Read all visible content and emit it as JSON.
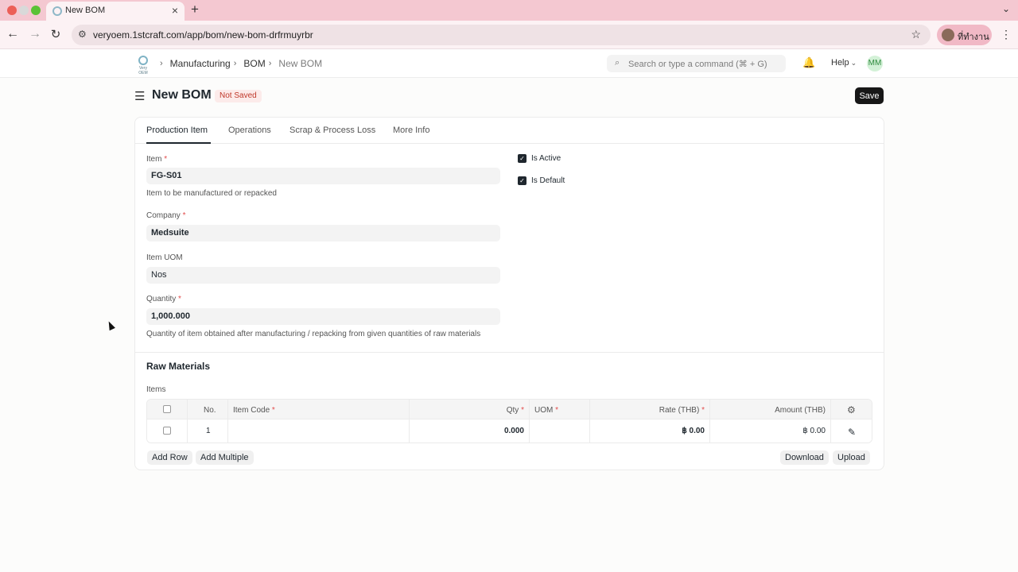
{
  "browser": {
    "tab_title": "New BOM",
    "tab_close": "×",
    "new_tab": "+",
    "tab_menu": "⌄",
    "nav_back": "←",
    "nav_forward": "→",
    "nav_reload": "↻",
    "site_info": "⚙",
    "url": "veryoem.1stcraft.com/app/bom/new-bom-drfrmuyrbr",
    "star": "☆",
    "profile_name": "ที่ทำงาน",
    "kebab": "⋮"
  },
  "navbar": {
    "logo_text": "Very OEM",
    "breadcrumbs": [
      "Manufacturing",
      "BOM",
      "New BOM"
    ],
    "crumb_separator": "›",
    "search_placeholder": "Search or type a command (⌘ + G)",
    "search_icon": "⌕",
    "bell_icon": "🔔",
    "help_label": "Help",
    "help_chevron": "⌄",
    "avatar_initials": "MM"
  },
  "page": {
    "menu_icon": "☰",
    "title": "New BOM",
    "status": "Not Saved",
    "save_label": "Save"
  },
  "tabs": [
    "Production Item",
    "Operations",
    "Scrap & Process Loss",
    "More Info"
  ],
  "form": {
    "item_label": "Item",
    "item_value": "FG-S01",
    "item_help": "Item to be manufactured or repacked",
    "company_label": "Company",
    "company_value": "Medsuite",
    "uom_label": "Item UOM",
    "uom_value": "Nos",
    "quantity_label": "Quantity",
    "quantity_value": "1,000.000",
    "quantity_help": "Quantity of item obtained after manufacturing / repacking from given quantities of raw materials",
    "required_mark": "*",
    "is_active_label": "Is Active",
    "is_active": true,
    "is_default_label": "Is Default",
    "is_default": true,
    "check_mark": "✓"
  },
  "raw_materials": {
    "section_title": "Raw Materials",
    "items_label": "Items",
    "columns": {
      "no": "No.",
      "item_code": "Item Code",
      "qty": "Qty",
      "uom": "UOM",
      "rate": "Rate (THB)",
      "amount": "Amount (THB)"
    },
    "settings_icon": "⚙",
    "edit_icon": "✎",
    "rows": [
      {
        "no": "1",
        "item_code": "",
        "qty": "0.000",
        "uom": "",
        "rate": "฿ 0.00",
        "amount": "฿ 0.00"
      }
    ],
    "add_row": "Add Row",
    "add_multiple": "Add Multiple",
    "download": "Download",
    "upload": "Upload"
  },
  "colors": {
    "titlebar": "#f4c8d1",
    "save_button": "#171717",
    "status_pill_bg": "#fcebea",
    "status_pill_text": "#c0392b",
    "avatar_bg": "#d3f1d7"
  }
}
